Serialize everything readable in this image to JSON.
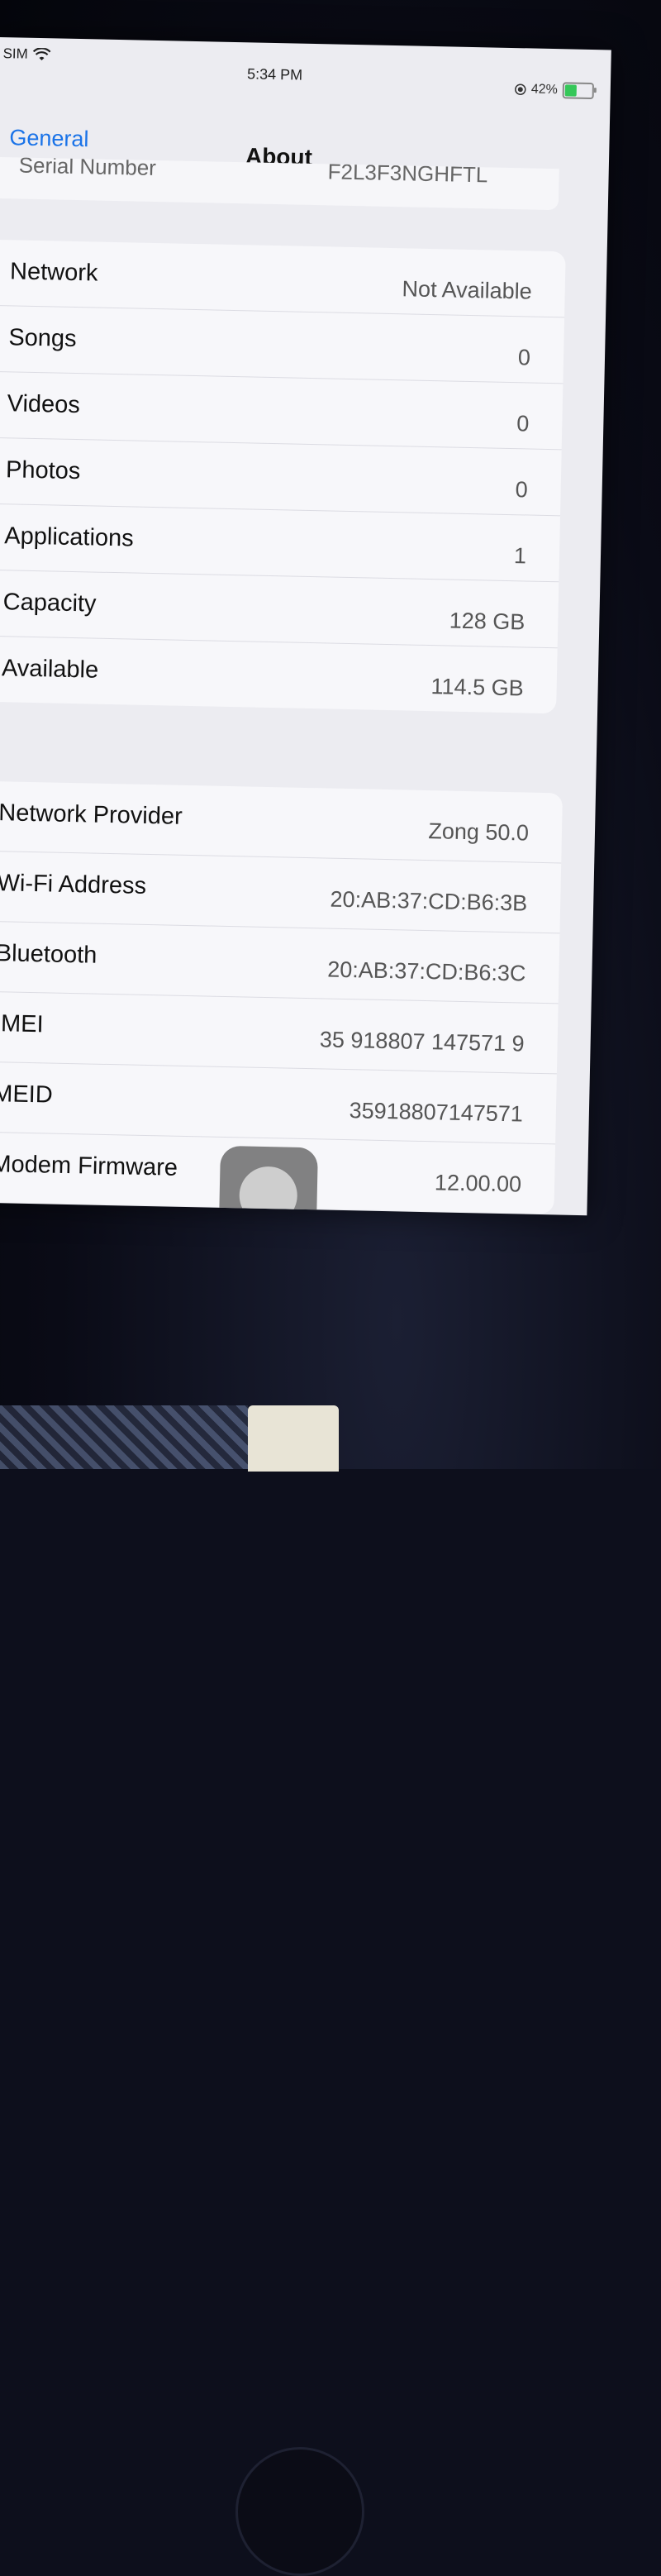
{
  "status_bar": {
    "carrier": "SIM",
    "time": "5:34 PM",
    "battery_percent": "42%",
    "battery_level": 0.42,
    "icons": [
      "wifi-icon",
      "location-icon",
      "battery-charging-icon"
    ]
  },
  "nav": {
    "back_label": "General",
    "title": "About"
  },
  "partial_row": {
    "label": "Serial Number",
    "value": "F2L3F3NGHFTL"
  },
  "media_group": [
    {
      "label": "Network",
      "value": "Not Available"
    },
    {
      "label": "Songs",
      "value": "0"
    },
    {
      "label": "Videos",
      "value": "0"
    },
    {
      "label": "Photos",
      "value": "0"
    },
    {
      "label": "Applications",
      "value": "1"
    },
    {
      "label": "Capacity",
      "value": "128 GB"
    },
    {
      "label": "Available",
      "value": "114.5 GB"
    }
  ],
  "network_group": [
    {
      "label": "Network Provider",
      "value": "Zong 50.0"
    },
    {
      "label": "Wi-Fi Address",
      "value": "20:AB:37:CD:B6:3B"
    },
    {
      "label": "Bluetooth",
      "value": "20:AB:37:CD:B6:3C"
    },
    {
      "label": "IMEI",
      "value": "35 918807 147571 9"
    },
    {
      "label": "MEID",
      "value": "35918807147571"
    },
    {
      "label": "Modem Firmware",
      "value": "12.00.00"
    }
  ],
  "colors": {
    "accent": "#1a73e8",
    "battery_fill": "#35c759"
  }
}
